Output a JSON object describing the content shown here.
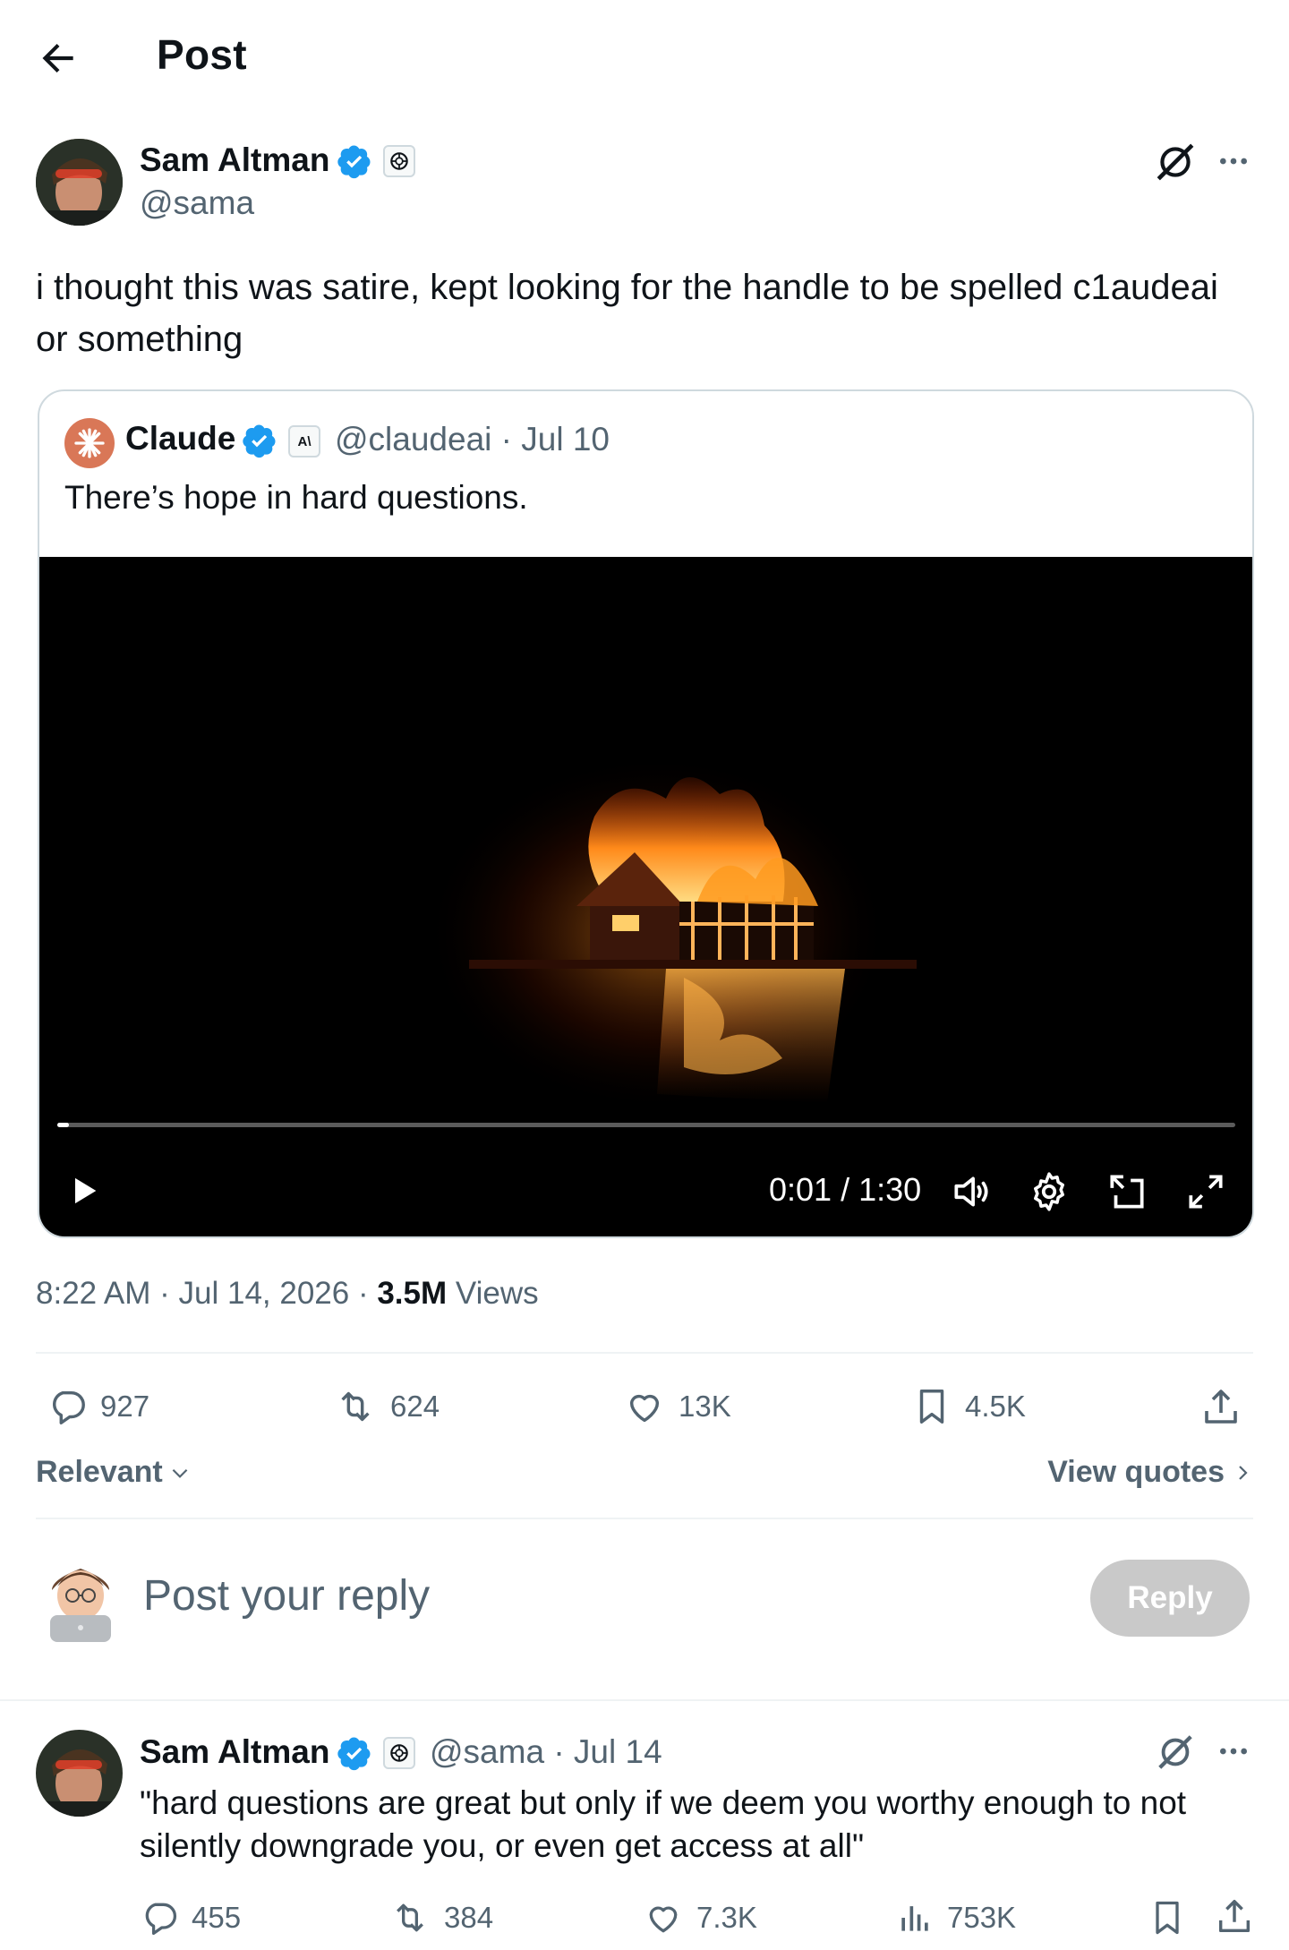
{
  "header": {
    "title": "Post"
  },
  "post": {
    "author_name": "Sam Altman",
    "author_handle": "@sama",
    "text": "i thought this was satire, kept looking for the handle to be spelled c1audeai or something",
    "timestamp": "8:22 AM · Jul 14, 2026 · ",
    "views_count": "3.5M",
    "views_label": " Views",
    "metrics": {
      "replies": "927",
      "reposts": "624",
      "likes": "13K",
      "bookmarks": "4.5K"
    }
  },
  "quote": {
    "author_name": "Claude",
    "affiliate_badge": "A\\",
    "meta": "@claudeai · Jul 10",
    "text": "There’s hope in hard questions.",
    "video": {
      "time": "0:01 / 1:30",
      "progress": 0.01
    }
  },
  "sort": {
    "label": "Relevant",
    "view_quotes": "View quotes"
  },
  "composer": {
    "placeholder": "Post your reply",
    "reply_button": "Reply"
  },
  "reply": {
    "author_name": "Sam Altman",
    "meta": "@sama · Jul 14",
    "text": "\"hard questions are great but only if we deem you worthy enough to not silently downgrade you, or even get access at all\"",
    "metrics": {
      "replies": "455",
      "reposts": "384",
      "likes": "7.3K",
      "views": "753K"
    }
  },
  "colors": {
    "verified": "#1d9bf0",
    "claude_brand": "#d97757",
    "reply_button_disabled": "#c9c9c9"
  }
}
